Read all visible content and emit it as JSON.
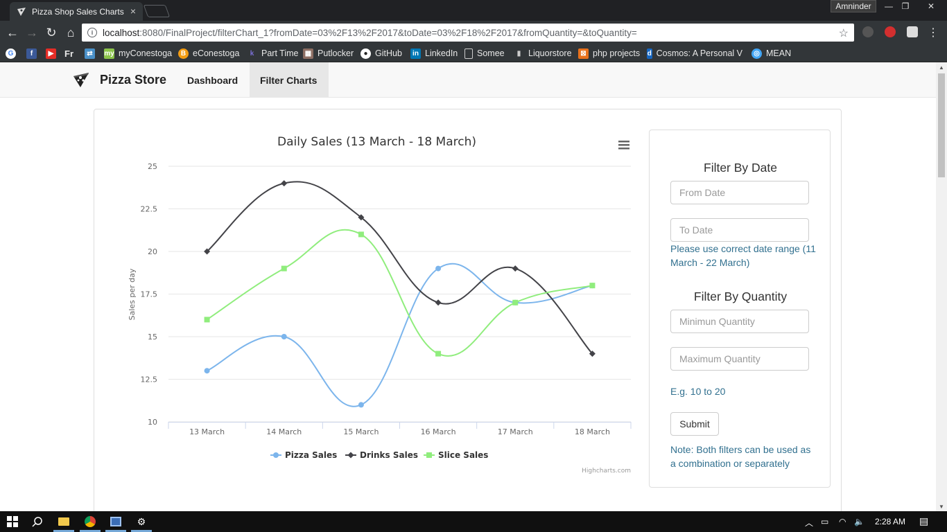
{
  "browser": {
    "tab_title": "Pizza Shop Sales Charts",
    "profile": "Amninder",
    "url_host": "localhost",
    "url_rest": ":8080/FinalProject/filterChart_1?fromDate=03%2F13%2F2017&toDate=03%2F18%2F2017&fromQuantity=&toQuantity=",
    "bookmarks": [
      "myConestoga",
      "eConestoga",
      "Part Time",
      "Putlocker",
      "GitHub",
      "LinkedIn",
      "Somee",
      "Liquorstore",
      "php projects",
      "Cosmos: A Personal V",
      "MEAN"
    ]
  },
  "navbar": {
    "brand": "Pizza Store",
    "links": [
      "Dashboard",
      "Filter Charts"
    ]
  },
  "chart_data": {
    "type": "line",
    "title": "Daily Sales (13 March - 18 March)",
    "ylabel": "Sales per day",
    "xlabel": "",
    "categories": [
      "13 March",
      "14 March",
      "15 March",
      "16 March",
      "17 March",
      "18 March"
    ],
    "ylim": [
      10,
      25
    ],
    "yticks": [
      "25",
      "22.5",
      "20",
      "17.5",
      "15",
      "12.5",
      "10"
    ],
    "yticks_values": [
      25,
      22.5,
      20,
      17.5,
      15,
      12.5,
      10
    ],
    "series": [
      {
        "name": "Pizza Sales",
        "values": [
          13,
          15,
          11,
          19,
          17,
          18
        ],
        "color": "#7cb5ec",
        "marker": "circle"
      },
      {
        "name": "Drinks Sales",
        "values": [
          20,
          24,
          22,
          17,
          19,
          14
        ],
        "color": "#434348",
        "marker": "diamond"
      },
      {
        "name": "Slice Sales",
        "values": [
          16,
          19,
          21,
          14,
          17,
          18
        ],
        "color": "#90ed7d",
        "marker": "square"
      }
    ],
    "grid": true,
    "legend": "bottom-center",
    "credit": "Highcharts.com"
  },
  "filter": {
    "date_heading": "Filter By Date",
    "from_placeholder": "From Date",
    "to_placeholder": "To Date",
    "date_help": "Please use correct date range (11 March - 22 March)",
    "qty_heading": "Filter By Quantity",
    "min_placeholder": "Minimun Quantity",
    "max_placeholder": "Maximum Quantity",
    "qty_help": "E.g. 10 to 20",
    "submit_label": "Submit",
    "note": "Note: Both filters can be used as a combination or separately"
  },
  "taskbar": {
    "time": "2:28 AM"
  }
}
